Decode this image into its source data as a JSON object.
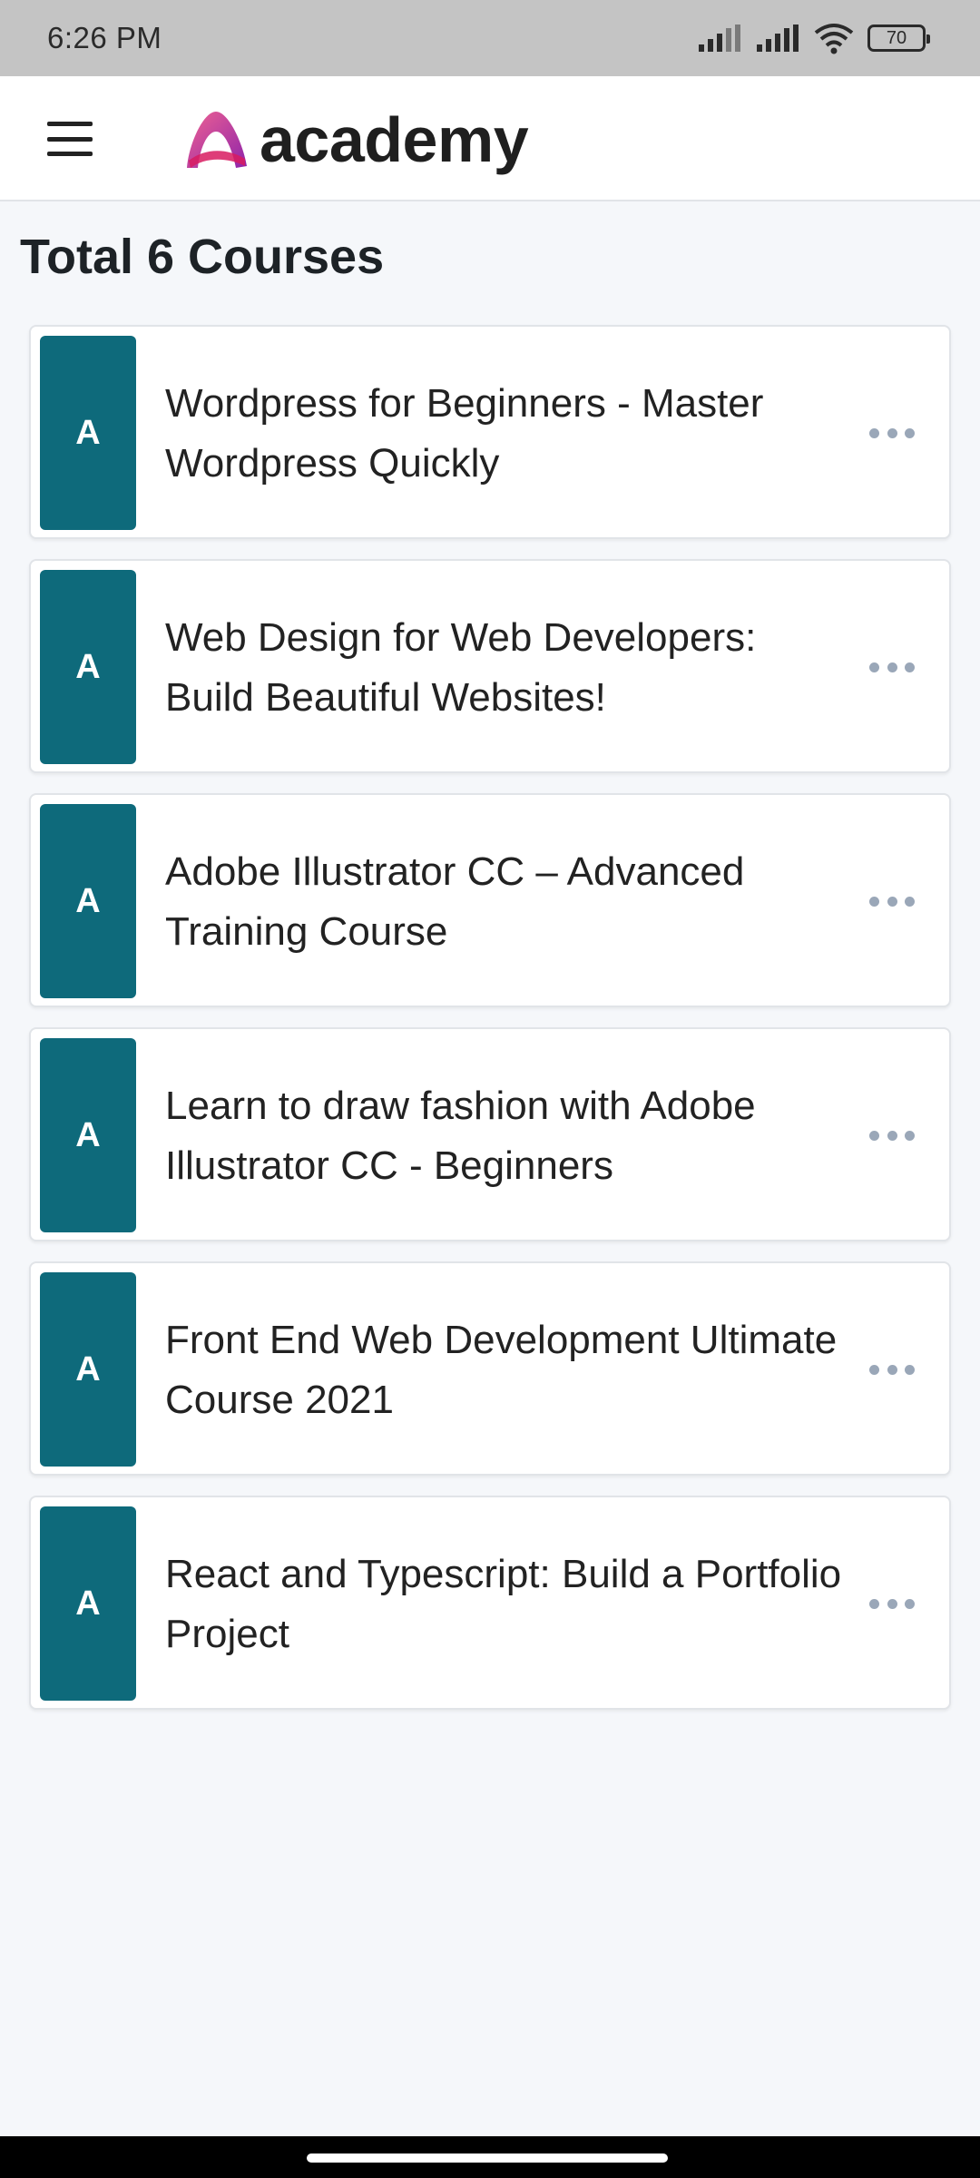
{
  "status_bar": {
    "time": "6:26 PM",
    "battery_level": "70",
    "icons": [
      "signal-icon",
      "signal-icon",
      "wifi-icon",
      "battery-icon"
    ]
  },
  "app_bar": {
    "menu_icon": "menu-icon",
    "brand_name": "academy",
    "logo_colors": [
      "#f06292",
      "#8e24aa"
    ]
  },
  "page": {
    "title": "Total 6 Courses"
  },
  "courses": [
    {
      "thumb_letter": "A",
      "title": "Wordpress for Beginners - Master Wordpress Quickly"
    },
    {
      "thumb_letter": "A",
      "title": "Web Design for Web Developers: Build Beautiful Websites!"
    },
    {
      "thumb_letter": "A",
      "title": "Adobe Illustrator CC – Advanced Training Course"
    },
    {
      "thumb_letter": "A",
      "title": "Learn to draw fashion with Adobe Illustrator CC - Beginners"
    },
    {
      "thumb_letter": "A",
      "title": "Front End Web Development Ultimate Course 2021"
    },
    {
      "thumb_letter": "A",
      "title": "React and Typescript: Build a Portfolio Project"
    }
  ],
  "colors": {
    "thumb_bg": "#0e6a7b",
    "page_bg": "#f5f7fa",
    "status_bar_bg": "#c4c4c4"
  }
}
